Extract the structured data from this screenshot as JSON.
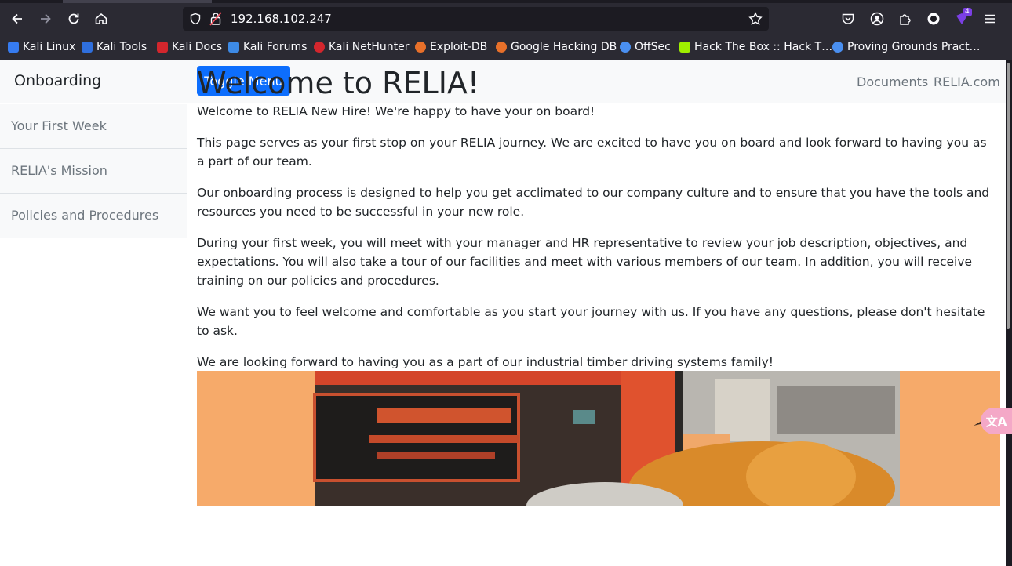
{
  "browser": {
    "url": "192.168.102.247",
    "extensions_badge": "4",
    "bookmarks": [
      {
        "label": "Kali Linux",
        "icon": "kali-dragon-icon"
      },
      {
        "label": "Kali Tools",
        "icon": "kali-tools-icon"
      },
      {
        "label": "Kali Docs",
        "icon": "kali-docs-icon"
      },
      {
        "label": "Kali Forums",
        "icon": "kali-forums-icon"
      },
      {
        "label": "Kali NetHunter",
        "icon": "nethunter-icon"
      },
      {
        "label": "Exploit-DB",
        "icon": "exploitdb-icon"
      },
      {
        "label": "Google Hacking DB",
        "icon": "ghdb-icon"
      },
      {
        "label": "OffSec",
        "icon": "offsec-icon"
      },
      {
        "label": "Hack The Box :: Hack T…",
        "icon": "htb-cube-icon"
      },
      {
        "label": "Proving Grounds Pract…",
        "icon": "offsec-icon"
      }
    ]
  },
  "sidebar": {
    "heading": "Onboarding",
    "items": [
      {
        "label": "Your First Week"
      },
      {
        "label": "RELIA's Mission"
      },
      {
        "label": "Policies and Procedures"
      }
    ]
  },
  "topnav": {
    "toggle_label": "Toggle Menu",
    "links": [
      {
        "label": "Documents"
      },
      {
        "label": "RELIA.com"
      }
    ]
  },
  "main": {
    "title": "Welcome to RELIA!",
    "paragraphs": [
      "Welcome to RELIA New Hire! We're happy to have your on board!",
      "This page serves as your first stop on your RELIA journey. We are excited to have you on board and look forward to having you as a part of our team.",
      "Our onboarding process is designed to help you get acclimated to our company culture and to ensure that you have the tools and resources you need to be successful in your new role.",
      "During your first week, you will meet with your manager and HR representative to review your job description, objectives, and expectations. You will also take a tour of our facilities and meet with various members of our team. In addition, you will receive training on our policies and procedures.",
      "We want you to feel welcome and comfortable as you start your journey with us. If you have any questions, please don't hesitate to ask.",
      "We are looking forward to having you as a part of our industrial timber driving systems family!"
    ]
  },
  "colors": {
    "primary": "#0d6efd",
    "browser_bg": "#2b2a33",
    "hero_bg": "#f6aa6a"
  }
}
